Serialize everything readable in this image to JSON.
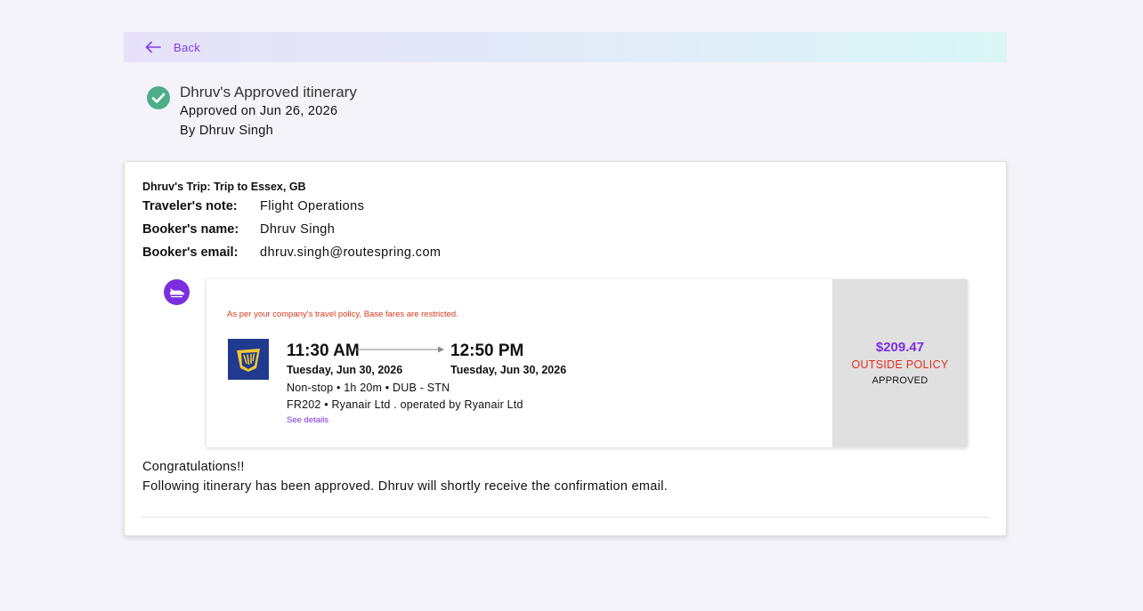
{
  "back": {
    "label": "Back",
    "icon": "arrow-left-icon"
  },
  "approval": {
    "title": "Dhruv's Approved itinerary",
    "approved_on": "Approved on Jun 26, 2026",
    "approved_by": "By Dhruv Singh",
    "icon": "check-circle-icon",
    "icon_color": "#4fae8a"
  },
  "trip": {
    "title": "Dhruv's Trip: Trip to Essex, GB",
    "fields": [
      {
        "label": "Traveler's note:",
        "value": "Flight Operations"
      },
      {
        "label": "Booker's name:",
        "value": "Dhruv Singh"
      },
      {
        "label": "Booker's email:",
        "value": "dhruv.singh@routespring.com"
      }
    ]
  },
  "flight": {
    "type_icon": "plane-icon",
    "policy_note": "As per your company's travel policy, Base fares are restricted.",
    "airline_logo": "ryanair-harp-logo",
    "departure_time": "11:30 AM",
    "arrival_time": "12:50 PM",
    "departure_date": "Tuesday, Jun 30, 2026",
    "arrival_date": "Tuesday, Jun 30, 2026",
    "route_info": "Non-stop • 1h 20m • DUB - STN",
    "flight_info": "FR202 • Ryanair Ltd . operated by Ryanair Ltd",
    "see_details": "See details",
    "price": "$209.47",
    "policy_status": "OUTSIDE POLICY",
    "approval_status": "APPROVED"
  },
  "footer": {
    "congrats": "Congratulations!!",
    "message": "Following itinerary has been approved. Dhruv will shortly receive the confirmation email."
  },
  "colors": {
    "accent": "#7a2ee0",
    "warning": "#d83a1d",
    "success": "#4fae8a"
  }
}
